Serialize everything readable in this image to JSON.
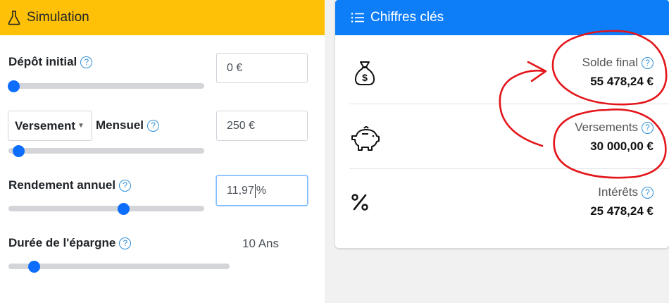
{
  "simulation": {
    "title": "Simulation",
    "fields": {
      "initial_deposit": {
        "label": "Dépôt initial",
        "value": "0 €",
        "slider_fraction": 0.0
      },
      "payment": {
        "type_select": "Versement",
        "frequency": "Mensuel",
        "value": "250 €",
        "slider_fraction": 0.03
      },
      "annual_return": {
        "label": "Rendement annuel",
        "value_before_caret": "11,97",
        "value_after_caret": "%",
        "slider_fraction": 0.59
      },
      "duration": {
        "label": "Durée de l'épargne",
        "value": "10 Ans",
        "slider_fraction": 0.12
      }
    }
  },
  "key_figures": {
    "title": "Chiffres clés",
    "rows": [
      {
        "label": "Solde final",
        "value": "55 478,24 €",
        "icon": "money-bag-icon"
      },
      {
        "label": "Versements",
        "value": "30 000,00 €",
        "icon": "piggy-bank-icon"
      },
      {
        "label": "Intérêts",
        "value": "25 478,24 €",
        "icon": "percent-icon"
      }
    ]
  },
  "help_glyph": "?",
  "colors": {
    "simulation_header": "#ffc107",
    "key_figures_header": "#0d7ef8",
    "slider_thumb": "#0d6efd",
    "help_icon": "#2f8fd8",
    "annotation": "#e3151a"
  }
}
